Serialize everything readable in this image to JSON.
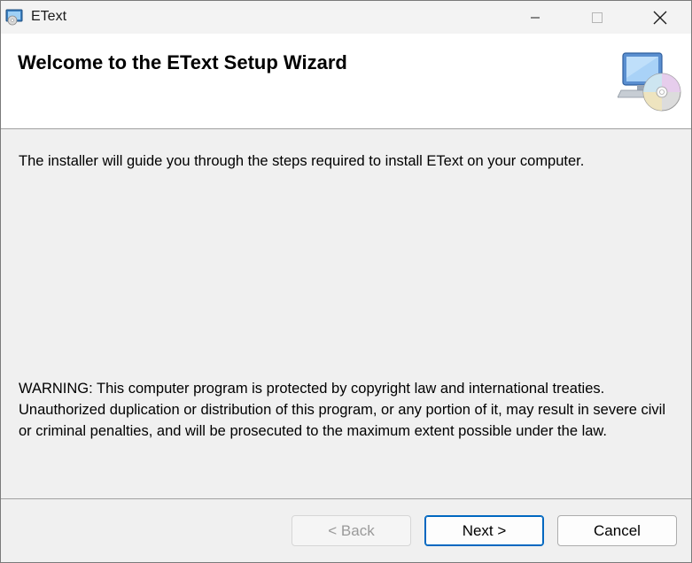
{
  "window": {
    "title": "EText",
    "controls": {
      "minimize_icon": "minimize-icon",
      "maximize_icon": "maximize-icon",
      "close_icon": "close-icon"
    }
  },
  "header": {
    "title": "Welcome to the EText Setup Wizard",
    "icon": "computer-cd-icon"
  },
  "body": {
    "intro": "The installer will guide you through the steps required to install EText on your computer.",
    "warning": "WARNING: This computer program is protected by copyright law and international treaties. Unauthorized duplication or distribution of this program, or any portion of it, may result in severe civil or criminal penalties, and will be prosecuted to the maximum extent possible under the law."
  },
  "footer": {
    "back_label": "< Back",
    "next_label": "Next >",
    "cancel_label": "Cancel"
  },
  "colors": {
    "accent": "#0067c0",
    "window_bg": "#f0f0f0",
    "banner_bg": "#ffffff",
    "disabled_text": "#9a9a9a"
  }
}
